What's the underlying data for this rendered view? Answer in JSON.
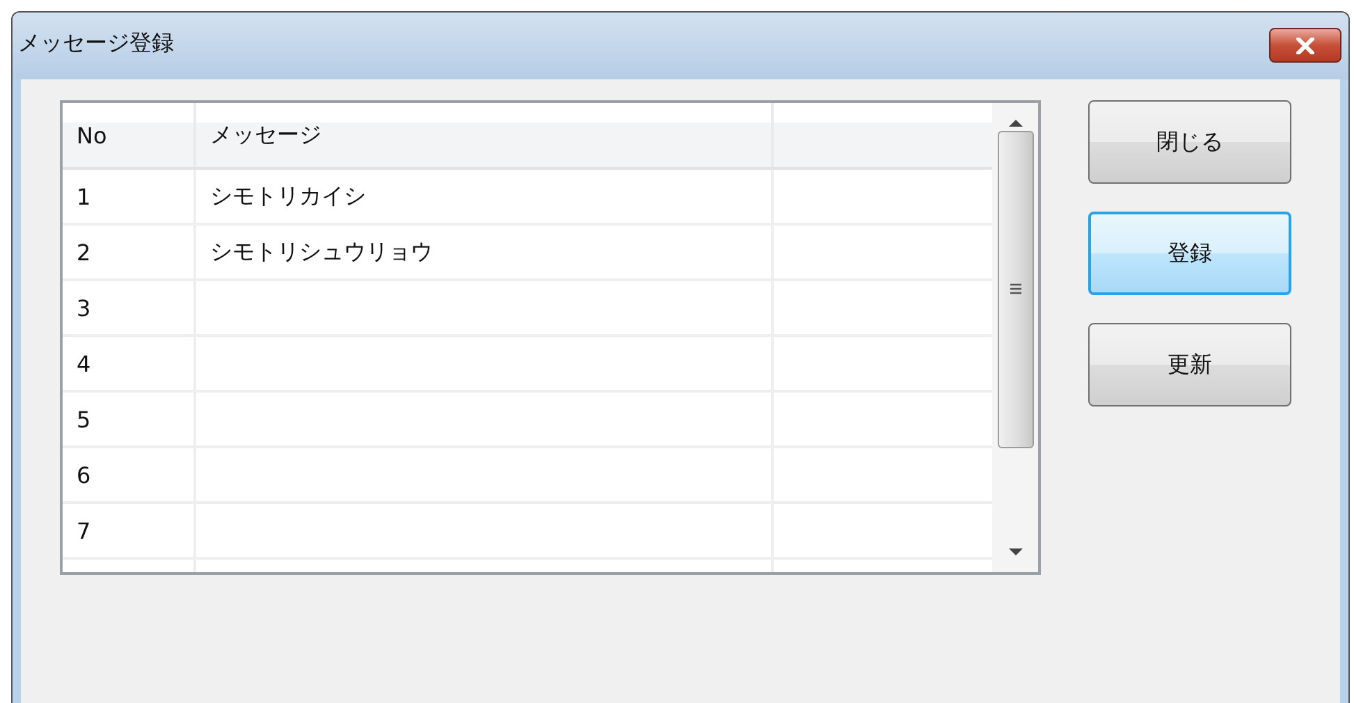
{
  "window": {
    "title": "メッセージ登録"
  },
  "table": {
    "columns": [
      "No",
      "メッセージ"
    ],
    "rows": [
      {
        "no": "1",
        "message": "シモトリカイシ"
      },
      {
        "no": "2",
        "message": "シモトリシュウリョウ"
      },
      {
        "no": "3"
      },
      {
        "no": "4"
      },
      {
        "no": "5"
      },
      {
        "no": "6"
      },
      {
        "no": "7"
      }
    ]
  },
  "buttons": [
    {
      "label": "閉じる",
      "focused": false
    },
    {
      "label": "登録",
      "focused": true
    },
    {
      "label": "更新",
      "focused": false
    }
  ]
}
